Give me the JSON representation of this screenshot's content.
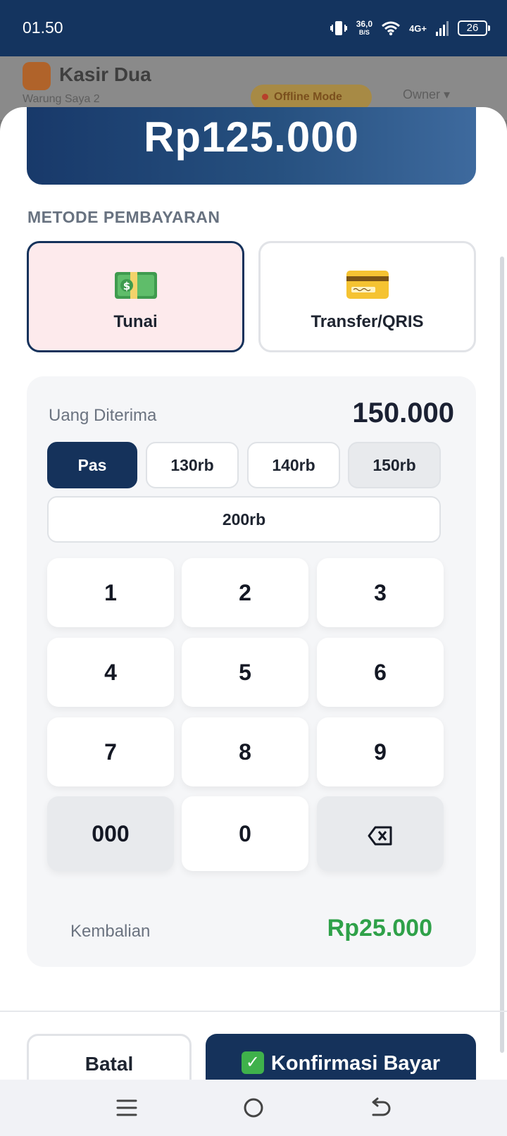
{
  "status_bar": {
    "time": "01.50",
    "speed_value": "36,0",
    "speed_unit": "B/S",
    "network": "4G+",
    "battery": "26"
  },
  "background_app": {
    "title": "Kasir Dua",
    "subtitle": "Warung Saya 2",
    "offline_badge": "Offline Mode",
    "user_menu": "Owner"
  },
  "payment": {
    "total": "Rp125.000",
    "section_label": "METODE PEMBAYARAN",
    "methods": [
      {
        "label": "Tunai",
        "icon": "banknote-icon",
        "selected": true
      },
      {
        "label": "Transfer/QRIS",
        "icon": "credit-card-icon",
        "selected": false
      }
    ],
    "received_label": "Uang Diterima",
    "received_value": "150.000",
    "quick_amounts": [
      "Pas",
      "130rb",
      "140rb",
      "150rb",
      "200rb"
    ],
    "keypad": [
      "1",
      "2",
      "3",
      "4",
      "5",
      "6",
      "7",
      "8",
      "9",
      "000",
      "0",
      "backspace"
    ],
    "change_label": "Kembalian",
    "change_value": "Rp25.000",
    "cancel_label": "Batal",
    "confirm_label": "Konfirmasi Bayar"
  },
  "colors": {
    "primary": "#15325b",
    "selected_method_bg": "#fdeaec",
    "change_green": "#2fa149",
    "panel_bg": "#f5f6f8"
  },
  "nav": {
    "icons": [
      "menu-icon",
      "home-icon",
      "back-icon"
    ]
  }
}
